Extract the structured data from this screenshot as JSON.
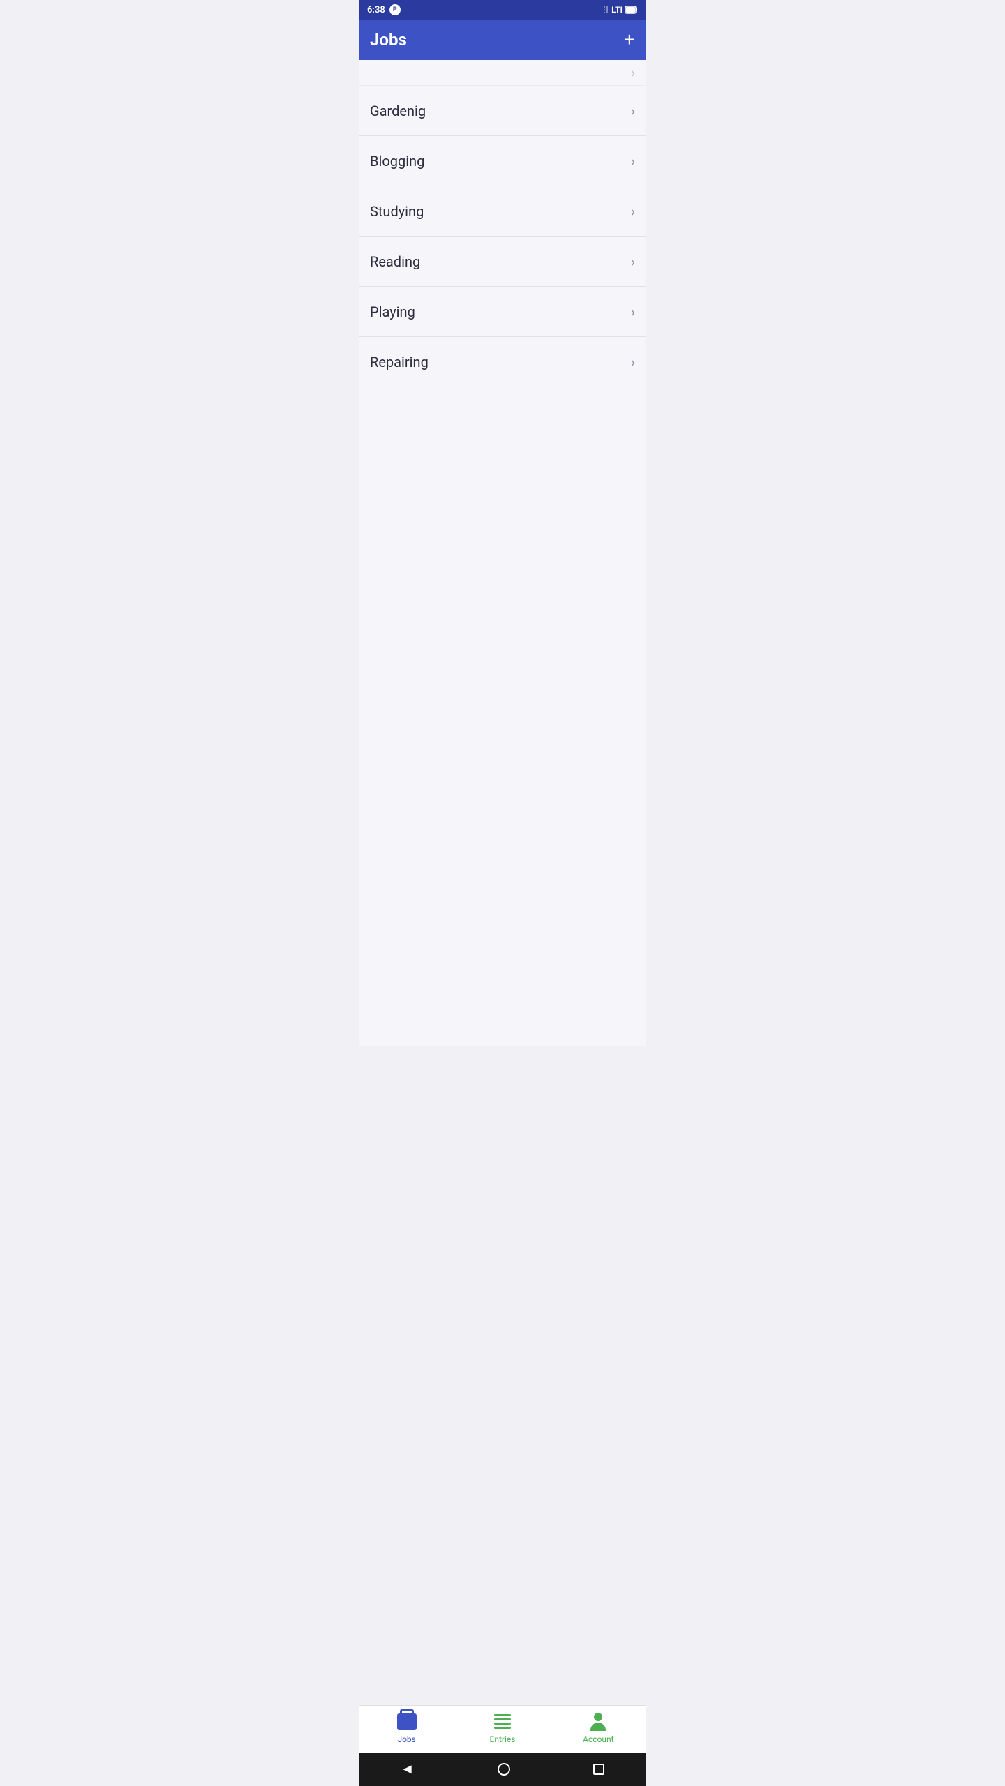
{
  "status_bar": {
    "time": "6:38",
    "icons": [
      "pocket",
      "signal",
      "lti",
      "battery"
    ]
  },
  "app_bar": {
    "title": "Jobs",
    "add_button_label": "+"
  },
  "jobs_list": {
    "items": [
      {
        "id": 1,
        "label": "Gardenig"
      },
      {
        "id": 2,
        "label": "Blogging"
      },
      {
        "id": 3,
        "label": "Studying"
      },
      {
        "id": 4,
        "label": "Reading"
      },
      {
        "id": 5,
        "label": "Playing"
      },
      {
        "id": 6,
        "label": "Repairing"
      }
    ]
  },
  "bottom_nav": {
    "items": [
      {
        "id": "jobs",
        "label": "Jobs",
        "active": true
      },
      {
        "id": "entries",
        "label": "Entries",
        "active": false
      },
      {
        "id": "account",
        "label": "Account",
        "active": false
      }
    ]
  },
  "colors": {
    "app_bar_bg": "#3d52c4",
    "status_bar_bg": "#2a3a9e",
    "list_bg": "#f5f5fa",
    "nav_active": "#3d52c4",
    "entries_color": "#4caf50",
    "account_color": "#4caf50"
  }
}
